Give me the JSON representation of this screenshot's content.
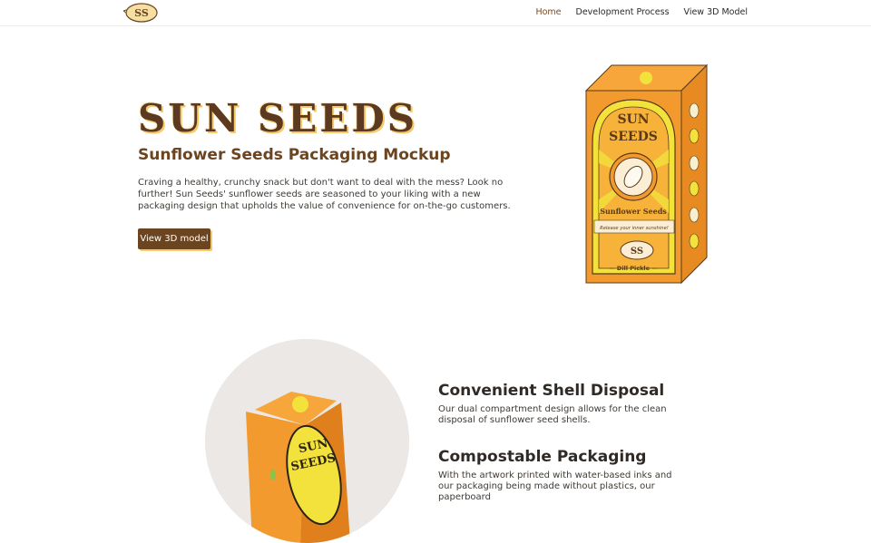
{
  "nav": {
    "logo_text": "SS",
    "links": [
      "Home",
      "Development Process",
      "View 3D Model"
    ]
  },
  "hero": {
    "brand": "SUN SEEDS",
    "subtitle": "Sunflower Seeds Packaging Mockup",
    "intro": "Craving a healthy, crunchy snack but don't want to deal with the mess? Look no further! Sun Seeds' sunflower seeds are seasoned to your liking with a new packaging design that upholds the value of convenience for on-the-go customers.",
    "button_label": "View 3D model"
  },
  "package": {
    "brand_line1": "SUN",
    "brand_line2": "SEEDS",
    "product_name": "Sunflower Seeds",
    "tagline": "Release your inner sunshine!",
    "logo_text": "SS",
    "flavor": "— Dill Pickle —"
  },
  "photo": {
    "brand_line1": "SUN",
    "brand_line2": "SEEDS"
  },
  "features": [
    {
      "title": "Convenient Shell Disposal",
      "text": "Our dual compartment design allows for the clean disposal of sunflower seed shells."
    },
    {
      "title": "Compostable Packaging",
      "text": "With the artwork printed with water-based inks and our packaging being made without plastics, our paperboard"
    }
  ],
  "colors": {
    "brown": "#6b4420",
    "orange": "#f29a2e",
    "yellow": "#f3e23c",
    "accent": "#f6c96a"
  }
}
